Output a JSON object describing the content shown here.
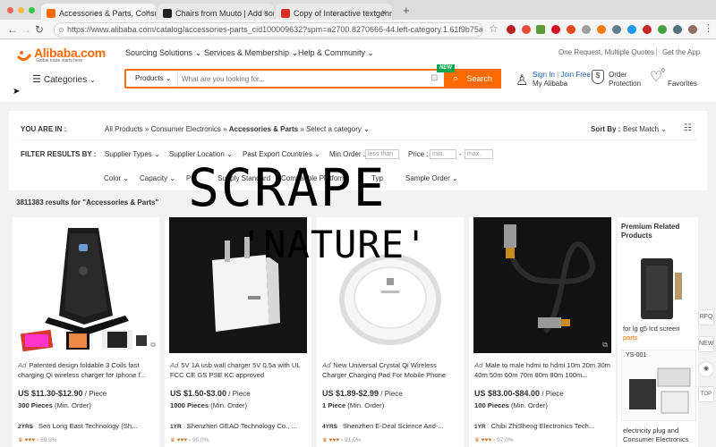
{
  "browser": {
    "tabs": [
      {
        "title": "Accessories & Parts, Consume",
        "active": true,
        "favicon_color": "#ff6a00"
      },
      {
        "title": "Chairs from Muuto | Add some",
        "active": false,
        "favicon_color": "#222222"
      },
      {
        "title": "Copy of Interactive textgenmi",
        "active": false,
        "favicon_color": "#d93025"
      }
    ],
    "new_tab": "+",
    "url": "https://www.alibaba.com/catalog/accessories-parts_cid100009632?spm=a2700.8270666-44.left-category.1.61f9b75aX8UNr2"
  },
  "header": {
    "logo_text": "Alibaba.com",
    "logo_tagline": "Global trade starts here",
    "nav": [
      "Sourcing Solutions",
      "Services & Membership",
      "Help & Community"
    ],
    "top_links": [
      "One Request, Multiple Quotes",
      "Get the App"
    ],
    "categories_label": "Categories",
    "search_category": "Products",
    "search_placeholder": "What are you looking for...",
    "search_button": "Search",
    "new_badge": "NEW",
    "signin": "Sign In",
    "join": "Join Free",
    "my_alibaba": "My Alibaba",
    "order": "Order",
    "protection": "Protection",
    "favorites": "Favorites"
  },
  "filters": {
    "you_are_in_label": "YOU ARE IN :",
    "breadcrumb": [
      "All Products",
      "Consumer Electronics",
      "Accessories & Parts",
      "Select a category"
    ],
    "sort_label": "Sort By :",
    "sort_value": "Best Match",
    "filter_label": "FILTER RESULTS BY :",
    "row1": [
      "Supplier Types",
      "Supplier Location",
      "Past Export Countries"
    ],
    "min_order_label": "Min Order :",
    "min_order_placeholder": "less than",
    "price_label": "Price :",
    "price_min": "min.",
    "price_max": "max.",
    "row2": [
      "Color",
      "Capacity",
      "P",
      "Supply Standard",
      "Compatible Platform",
      "Typ",
      "Sample Order"
    ]
  },
  "results_text": "3811383 results for \"Accessories & Parts\"",
  "overlay": {
    "line1": "SCRAPE",
    "line2": "'NATURE'"
  },
  "products": [
    {
      "ad": "Ad",
      "title": "Patented design foldable 3 Coils fast charging Qi wireless charger for Iphone f...",
      "price": "US $11.30-$12.90",
      "unit": " / Piece",
      "moq_qty": "300 Pieces",
      "moq_label": " (Min. Order)",
      "years": "2YRS",
      "supplier": "Sen Long East Technology (Sh...",
      "rate": "89.9%"
    },
    {
      "ad": "Ad",
      "title": "5V 1A usb wall charger 5V 0.5a with UL FCC CE GS PSE KC approved",
      "price": "US $1.50-$3.00",
      "unit": " / Piece",
      "moq_qty": "1000 Pieces",
      "moq_label": " (Min. Order)",
      "years": "1YR",
      "supplier": "Shenzhen GEAO Technology Co., ...",
      "rate": "90.0%"
    },
    {
      "ad": "Ad",
      "title": "New Universal Crystal Qi Wireless Charger Charging Pad For Mobile Phone",
      "price": "US $1.89-$2.99",
      "unit": " / Piece",
      "moq_qty": "1 Piece",
      "moq_label": " (Min. Order)",
      "years": "4YRS",
      "supplier": "Shenzhen E-Deal Science And-...",
      "rate": "91.0%"
    },
    {
      "ad": "Ad",
      "title": "Male to male hdmi to hdmi 10m 20m 30m 40m 50m 60m 70m 80m 90m 100m...",
      "price": "US $83.00-$84.00",
      "unit": " / Piece",
      "moq_qty": "100 Pieces",
      "moq_label": " (Min. Order)",
      "years": "1YR",
      "supplier": "Chibi ZhiSheng Electronics Tech...",
      "rate": "97.0%"
    }
  ],
  "premium": {
    "title": "Premium Related Products",
    "item1": "for lg g5 lcd screen",
    "item1_accent": "parts",
    "yscode": "YS-001",
    "item2": "electricity plug and Consumer Electronics"
  },
  "side_icons": [
    "RFQ",
    "NEW",
    "TOP"
  ],
  "colors": {
    "brand": "#ff6a00",
    "new_badge": "#00a650",
    "accent_text": "#ff6a00"
  }
}
